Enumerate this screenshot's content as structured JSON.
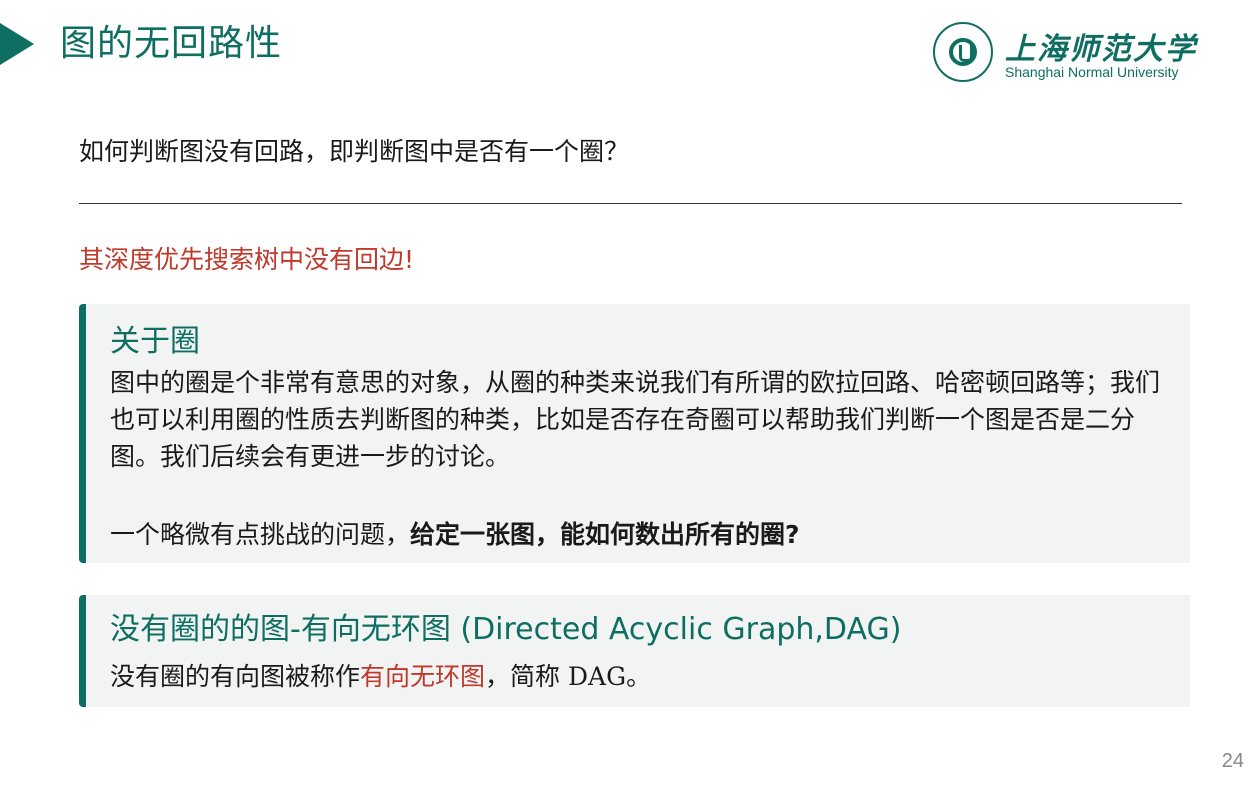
{
  "header": {
    "title": "图的无回路性",
    "logo_cn": "上海师范大学",
    "logo_en": "Shanghai Normal University"
  },
  "question": "如何判断图没有回路，即判断图中是否有一个圈？",
  "answer": "其深度优先搜索树中没有回边!",
  "box1": {
    "title": "关于圈",
    "paragraph1": "图中的圈是个非常有意思的对象，从圈的种类来说我们有所谓的欧拉回路、哈密顿回路等；我们也可以利用圈的性质去判断图的种类，比如是否存在奇圈可以帮助我们判断一个图是否是二分图。我们后续会有更进一步的讨论。",
    "paragraph2_prefix": "一个略微有点挑战的问题，",
    "paragraph2_bold": "给定一张图，能如何数出所有的圈?"
  },
  "box2": {
    "title": "没有圈的的图-有向无环图 (Directed Acyclic Graph,DAG)",
    "body_prefix": "没有圈的有向图被称作",
    "body_highlight": "有向无环图",
    "body_middle": "，简称 ",
    "body_abbrev": "DAG",
    "body_suffix": "。"
  },
  "page_number": "24",
  "colors": {
    "accent": "#0e6e62",
    "highlight": "#c0392b",
    "box_bg": "#f2f4f4"
  }
}
